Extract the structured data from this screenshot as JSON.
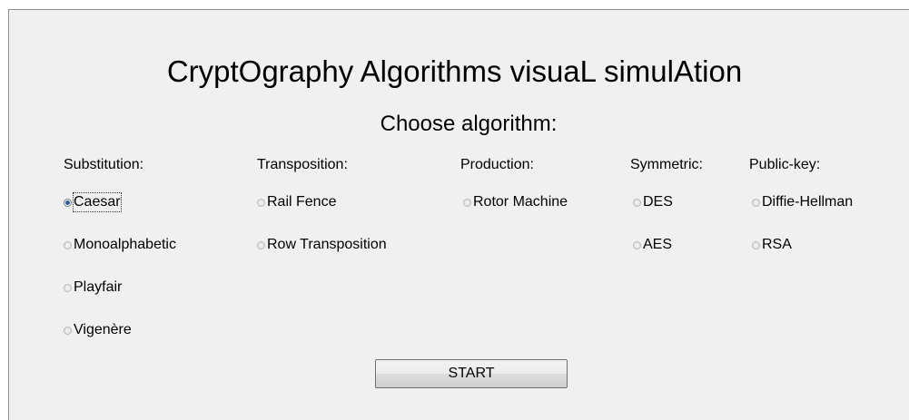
{
  "title": "CryptOgraphy Algorithms visuaL simulAtion",
  "subtitle": "Choose algorithm:",
  "columns": [
    {
      "header": "Substitution:",
      "options": [
        {
          "label": "Caesar",
          "checked": true,
          "focused": true
        },
        {
          "label": "Monoalphabetic",
          "checked": false
        },
        {
          "label": "Playfair",
          "checked": false
        },
        {
          "label": "Vigenère",
          "checked": false
        }
      ]
    },
    {
      "header": "Transposition:",
      "options": [
        {
          "label": "Rail Fence",
          "checked": false
        },
        {
          "label": "Row Transposition",
          "checked": false
        }
      ]
    },
    {
      "header": "Production:",
      "options": [
        {
          "label": "Rotor Machine",
          "checked": false
        }
      ]
    },
    {
      "header": "Symmetric:",
      "options": [
        {
          "label": "DES",
          "checked": false
        },
        {
          "label": "AES",
          "checked": false
        }
      ]
    },
    {
      "header": "Public-key:",
      "options": [
        {
          "label": "Diffie-Hellman",
          "checked": false
        },
        {
          "label": "RSA",
          "checked": false
        }
      ]
    }
  ],
  "start_label": "START"
}
